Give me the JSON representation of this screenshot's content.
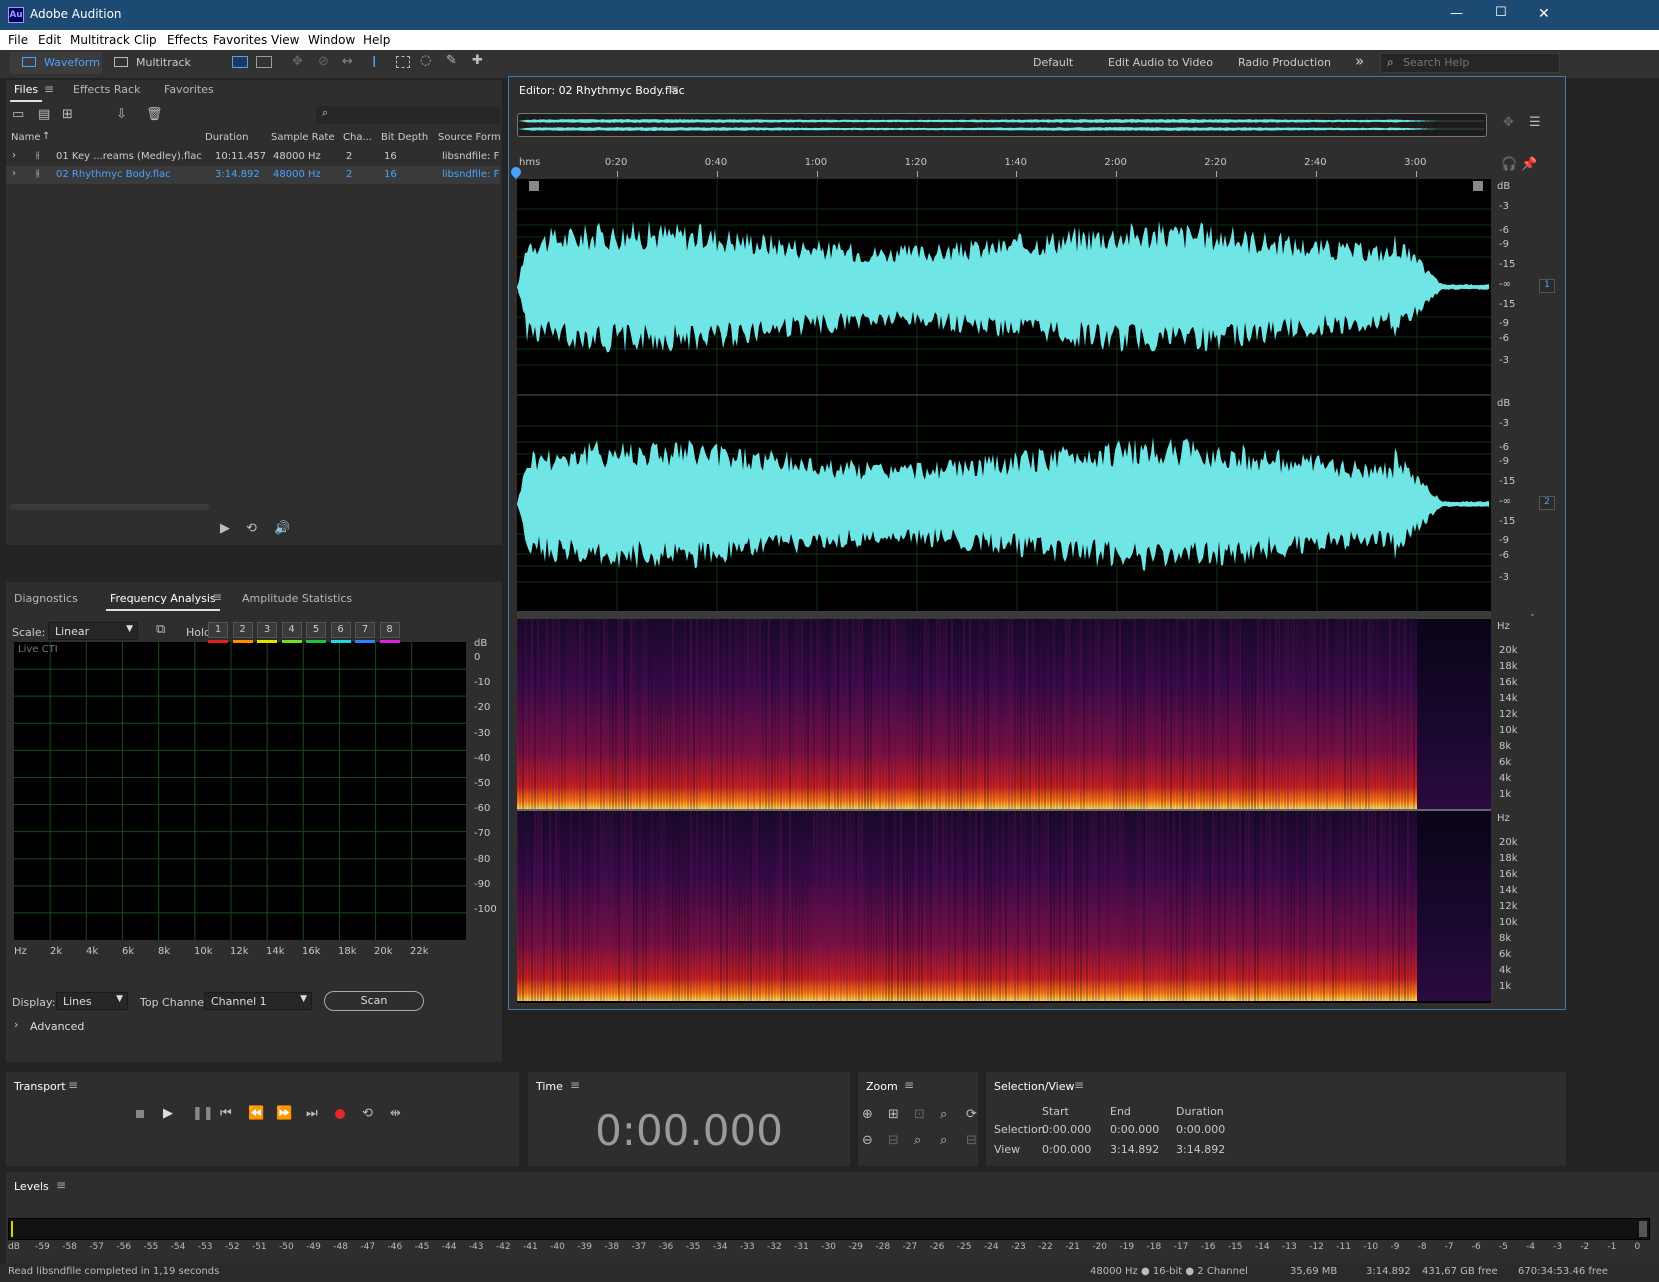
{
  "app": {
    "icon_text": "Au",
    "title": "Adobe Audition"
  },
  "window_controls": {
    "minimize": "—",
    "maximize": "☐",
    "close": "✕"
  },
  "menu": [
    "File",
    "Edit",
    "Multitrack",
    "Clip",
    "Effects",
    "Favorites",
    "View",
    "Window",
    "Help"
  ],
  "toolbar": {
    "waveform": "Waveform",
    "multitrack": "Multitrack",
    "workspaces": [
      "Default",
      "Edit Audio to Video",
      "Radio Production"
    ],
    "more": "»",
    "search_placeholder": "Search Help"
  },
  "files_panel": {
    "tabs": [
      "Files",
      "Effects Rack",
      "Favorites"
    ],
    "columns": [
      "Name",
      "Duration",
      "Sample Rate",
      "Cha...",
      "Bit Depth",
      "Source Form..."
    ],
    "rows": [
      {
        "name": "01 Key ...reams (Medley).flac",
        "duration": "10:11.457",
        "rate": "48000 Hz",
        "channels": "2",
        "depth": "16",
        "format": "libsndfile: FL"
      },
      {
        "name": "02 Rhythmyc Body.flac",
        "duration": "3:14.892",
        "rate": "48000 Hz",
        "channels": "2",
        "depth": "16",
        "format": "libsndfile: FL"
      }
    ]
  },
  "analysis_panel": {
    "tabs": [
      "Diagnostics",
      "Frequency Analysis",
      "Amplitude Statistics"
    ],
    "scale_label": "Scale:",
    "scale_value": "Linear",
    "hold_label": "Hold:",
    "holds": [
      {
        "label": "1",
        "color": "#e02020"
      },
      {
        "label": "2",
        "color": "#ff8c00"
      },
      {
        "label": "3",
        "color": "#e8e000"
      },
      {
        "label": "4",
        "color": "#70e020"
      },
      {
        "label": "5",
        "color": "#20c040"
      },
      {
        "label": "6",
        "color": "#20d8e0"
      },
      {
        "label": "7",
        "color": "#3080ff"
      },
      {
        "label": "8",
        "color": "#e020e0"
      }
    ],
    "graph_label": "Live CTI",
    "db_label": "dB",
    "db_ticks": [
      "0",
      "-10",
      "-20",
      "-30",
      "-40",
      "-50",
      "-60",
      "-70",
      "-80",
      "-90",
      "-100"
    ],
    "hz_ticks": [
      "Hz",
      "2k",
      "4k",
      "6k",
      "8k",
      "10k",
      "12k",
      "14k",
      "16k",
      "18k",
      "20k",
      "22k"
    ],
    "display_label": "Display:",
    "display_value": "Lines",
    "top_channel_label": "Top Channel:",
    "top_channel_value": "Channel 1",
    "scan_label": "Scan",
    "advanced_label": "Advanced"
  },
  "editor": {
    "title": "Editor: 02 Rhythmyc Body.flac",
    "ruler_unit": "hms",
    "ruler_ticks": [
      "0:20",
      "0:40",
      "1:00",
      "1:20",
      "1:40",
      "2:00",
      "2:20",
      "2:40",
      "3:00"
    ],
    "db_label": "dB",
    "db_ticks": [
      "-3",
      "-6",
      "-9",
      "-15",
      "-∞",
      "-15",
      "-9",
      "-6",
      "-3"
    ],
    "channels": [
      "1",
      "2"
    ],
    "hz_label": "Hz",
    "hz_ticks": [
      "20k",
      "18k",
      "16k",
      "14k",
      "12k",
      "10k",
      "8k",
      "6k",
      "4k",
      "1k"
    ],
    "waveform_color": "#6fe5e5"
  },
  "transport": {
    "title": "Transport"
  },
  "time": {
    "title": "Time",
    "value": "0:00.000"
  },
  "zoom": {
    "title": "Zoom"
  },
  "selection": {
    "title": "Selection/View",
    "cols": [
      "Start",
      "End",
      "Duration"
    ],
    "rows": [
      {
        "label": "Selection",
        "start": "0:00.000",
        "end": "0:00.000",
        "duration": "0:00.000"
      },
      {
        "label": "View",
        "start": "0:00.000",
        "end": "3:14.892",
        "duration": "3:14.892"
      }
    ]
  },
  "levels": {
    "title": "Levels",
    "ticks": [
      "dB",
      "-59",
      "-58",
      "-57",
      "-56",
      "-55",
      "-54",
      "-53",
      "-52",
      "-51",
      "-50",
      "-49",
      "-48",
      "-47",
      "-46",
      "-45",
      "-44",
      "-43",
      "-42",
      "-41",
      "-40",
      "-39",
      "-38",
      "-37",
      "-36",
      "-35",
      "-34",
      "-33",
      "-32",
      "-31",
      "-30",
      "-29",
      "-28",
      "-27",
      "-26",
      "-25",
      "-24",
      "-23",
      "-22",
      "-21",
      "-20",
      "-19",
      "-18",
      "-17",
      "-16",
      "-15",
      "-14",
      "-13",
      "-12",
      "-11",
      "-10",
      "-9",
      "-8",
      "-7",
      "-6",
      "-5",
      "-4",
      "-3",
      "-2",
      "-1",
      "0"
    ]
  },
  "status": {
    "message": "Read libsndfile completed in 1,19 seconds",
    "format": "48000 Hz ● 16-bit ● 2 Channel",
    "size": "35,69 MB",
    "duration": "3:14.892",
    "free": "431,67 GB free",
    "time_free": "670:34:53.46 free"
  }
}
